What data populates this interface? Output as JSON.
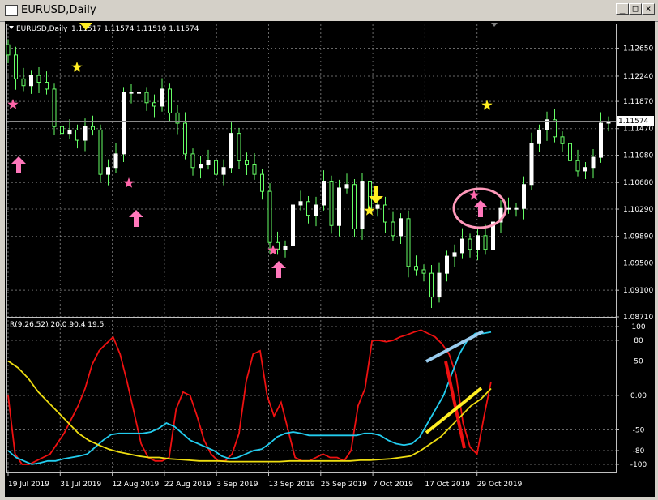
{
  "window": {
    "title": "EURUSD,Daily",
    "buttons": {
      "minimize": "_",
      "maximize": "□",
      "close": "×"
    }
  },
  "chart": {
    "symbol_label": "EURUSD,Daily",
    "ohlc_label": "1.11517 1.11574 1.11510 1.11574",
    "current_price": "1.11574",
    "price_ticks": [
      "1.12650",
      "1.12240",
      "1.11870",
      "1.11470",
      "1.11080",
      "1.10680",
      "1.10290",
      "1.09890",
      "1.09500",
      "1.09100",
      "1.08710"
    ],
    "date_ticks": [
      "19 Jul 2019",
      "31 Jul 2019",
      "12 Aug 2019",
      "22 Aug 2019",
      "3 Sep 2019",
      "13 Sep 2019",
      "25 Sep 2019",
      "7 Oct 2019",
      "17 Oct 2019",
      "29 Oct 2019"
    ],
    "colors": {
      "background": "#000000",
      "grid": "#c0c0c0",
      "bull": "#ffffff",
      "bear": "#66ff66",
      "wick": "#66ff66",
      "text": "#ffffff",
      "star_pink": "#ff66aa",
      "star_yellow": "#ffee22",
      "arrow_pink": "#ff77bb",
      "arrow_yellow": "#ffee22"
    }
  },
  "indicator": {
    "label": "R(9,26,52) 20.0 90.4 19.5",
    "ticks": [
      "100",
      "80",
      "50",
      "0.00",
      "-50",
      "-80",
      "-100"
    ],
    "series_colors": {
      "fast": "#ee1111",
      "mid": "#22ccee",
      "slow": "#eedd11"
    }
  },
  "chart_data": {
    "type": "candlestick",
    "x": [
      "15 Jul",
      "16 Jul",
      "17 Jul",
      "18 Jul",
      "19 Jul",
      "22 Jul",
      "23 Jul",
      "24 Jul",
      "25 Jul",
      "26 Jul",
      "29 Jul",
      "30 Jul",
      "31 Jul",
      "1 Aug",
      "2 Aug",
      "5 Aug",
      "6 Aug",
      "7 Aug",
      "8 Aug",
      "9 Aug",
      "12 Aug",
      "13 Aug",
      "14 Aug",
      "15 Aug",
      "16 Aug",
      "19 Aug",
      "20 Aug",
      "21 Aug",
      "22 Aug",
      "23 Aug",
      "26 Aug",
      "27 Aug",
      "28 Aug",
      "29 Aug",
      "30 Aug",
      "2 Sep",
      "3 Sep",
      "4 Sep",
      "5 Sep",
      "6 Sep",
      "9 Sep",
      "10 Sep",
      "11 Sep",
      "12 Sep",
      "13 Sep",
      "16 Sep",
      "17 Sep",
      "18 Sep",
      "19 Sep",
      "20 Sep",
      "23 Sep",
      "24 Sep",
      "25 Sep",
      "26 Sep",
      "27 Sep",
      "30 Sep",
      "1 Oct",
      "2 Oct",
      "3 Oct",
      "4 Oct",
      "7 Oct",
      "8 Oct",
      "9 Oct",
      "10 Oct",
      "11 Oct",
      "14 Oct",
      "15 Oct",
      "16 Oct",
      "17 Oct",
      "18 Oct",
      "21 Oct",
      "22 Oct",
      "23 Oct",
      "24 Oct",
      "25 Oct",
      "28 Oct",
      "29 Oct",
      "30 Oct",
      "31 Oct"
    ],
    "close": [
      1.1255,
      1.122,
      1.121,
      1.1225,
      1.1215,
      1.1205,
      1.115,
      1.114,
      1.1145,
      1.113,
      1.115,
      1.1145,
      1.108,
      1.109,
      1.111,
      1.12,
      1.12,
      1.12,
      1.1185,
      1.118,
      1.1205,
      1.117,
      1.1155,
      1.111,
      1.109,
      1.1095,
      1.11,
      1.108,
      1.109,
      1.114,
      1.11,
      1.1095,
      1.108,
      1.1055,
      1.098,
      1.097,
      1.0975,
      1.1035,
      1.104,
      1.102,
      1.1035,
      1.107,
      1.1005,
      1.106,
      1.1065,
      1.1,
      1.107,
      1.103,
      1.1035,
      1.101,
      1.099,
      1.1015,
      1.0945,
      1.094,
      1.0935,
      1.09,
      1.0935,
      1.096,
      1.0965,
      1.0985,
      1.097,
      1.099,
      1.097,
      1.101,
      1.103,
      1.103,
      1.103,
      1.1065,
      1.1125,
      1.1145,
      1.116,
      1.1135,
      1.1125,
      1.11,
      1.1085,
      1.109,
      1.1105,
      1.1155,
      1.1157
    ],
    "ylim": [
      1.0871,
      1.13
    ],
    "indicator": {
      "label": "R(9,26,52)",
      "ylim": [
        -100,
        100
      ],
      "series": [
        {
          "values": [
            0,
            -85,
            -100,
            -100,
            -95,
            -90,
            -85,
            -70,
            -55,
            -35,
            -15,
            10,
            45,
            65,
            75,
            85,
            60,
            20,
            -25,
            -70,
            -90,
            -95,
            -95,
            -90,
            -20,
            5,
            0,
            -30,
            -65,
            -85,
            -95,
            -95,
            -85,
            -55,
            20,
            60,
            65,
            0,
            -30,
            -10,
            -50,
            -90,
            -95,
            -95,
            -90,
            -85,
            -90,
            -90,
            -95,
            -80,
            -15,
            10,
            80,
            80,
            78,
            80,
            85,
            88,
            92,
            95,
            90,
            85,
            75,
            60,
            30,
            -40,
            -75,
            -85,
            -30,
            20
          ]
        },
        {
          "values": [
            -80,
            -90,
            -95,
            -100,
            -98,
            -95,
            -95,
            -92,
            -90,
            -88,
            -85,
            -75,
            -65,
            -57,
            -55,
            -55,
            -55,
            -55,
            -53,
            -48,
            -40,
            -45,
            -55,
            -65,
            -70,
            -75,
            -80,
            -88,
            -92,
            -90,
            -85,
            -80,
            -78,
            -70,
            -60,
            -55,
            -53,
            -55,
            -58,
            -58,
            -58,
            -58,
            -58,
            -58,
            -58,
            -55,
            -55,
            -58,
            -65,
            -70,
            -72,
            -70,
            -60,
            -40,
            -20,
            0,
            30,
            60,
            80,
            90,
            90,
            92
          ]
        },
        {
          "values": [
            50,
            40,
            25,
            5,
            -10,
            -25,
            -40,
            -55,
            -65,
            -72,
            -78,
            -82,
            -85,
            -88,
            -90,
            -90,
            -92,
            -93,
            -94,
            -95,
            -95,
            -95,
            -96,
            -96,
            -96,
            -96,
            -96,
            -96,
            -95,
            -95,
            -95,
            -95,
            -95,
            -95,
            -95,
            -94,
            -94,
            -93,
            -92,
            -90,
            -88,
            -80,
            -70,
            -60,
            -45,
            -30,
            -15,
            -5,
            10
          ]
        }
      ]
    }
  }
}
